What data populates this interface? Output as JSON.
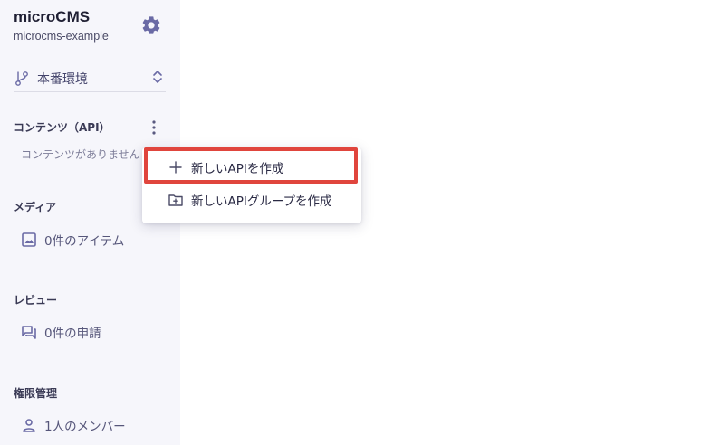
{
  "brand": {
    "name": "microCMS",
    "service_id": "microcms-example"
  },
  "environment": {
    "label": "本番環境"
  },
  "content_section": {
    "title": "コンテンツ（API）",
    "empty_text": "コンテンツがありません"
  },
  "media_section": {
    "title": "メディア",
    "item_label": "0件のアイテム"
  },
  "review_section": {
    "title": "レビュー",
    "item_label": "0件の申請"
  },
  "permissions_section": {
    "title": "権限管理",
    "item_label": "1人のメンバー"
  },
  "context_menu": {
    "items": [
      {
        "label": "新しいAPIを作成",
        "icon": "plus-icon"
      },
      {
        "label": "新しいAPIグループを作成",
        "icon": "folder-plus-icon"
      }
    ]
  },
  "colors": {
    "sidebar_bg": "#f6f6fb",
    "accent": "#6a6aa5",
    "highlight": "#e0453d"
  }
}
